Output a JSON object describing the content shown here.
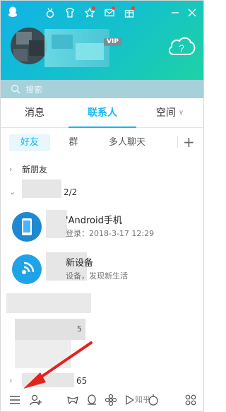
{
  "header": {
    "top_icons": [
      "medal-icon",
      "tshirt-icon",
      "star-icon",
      "mail-icon",
      "gift-icon"
    ],
    "window_controls": [
      "minimize-icon",
      "close-icon"
    ],
    "vip_badge": "VIP",
    "colors": {
      "gradient_start": "#12b2e6",
      "gradient_end": "#1fd2a4",
      "accent": "#12b7f5"
    }
  },
  "search": {
    "placeholder": "搜索"
  },
  "tabs": {
    "messages": "消息",
    "contacts": "联系人",
    "space": "空间"
  },
  "subtabs": {
    "friends": "好友",
    "groups": "群",
    "multichat": "多人聊天",
    "add": "+"
  },
  "groups_list": {
    "new_friends": "新朋友",
    "group2_count": "2/2",
    "last_group_count": "65"
  },
  "contacts": [
    {
      "name_suffix": "'Android手机",
      "subtitle": "登录：2018-3-17 12:29"
    },
    {
      "name_suffix": "新设备",
      "subtitle": "设备，发现新生活"
    }
  ],
  "partial_counts": {
    "row_a": "5"
  },
  "bottom_icons": [
    "menu-icon",
    "add-contact-icon",
    "game-icon",
    "penguin-icon",
    "flower-icon",
    "video-icon",
    "wallet-icon",
    "apps-icon"
  ],
  "watermark": "知乎"
}
